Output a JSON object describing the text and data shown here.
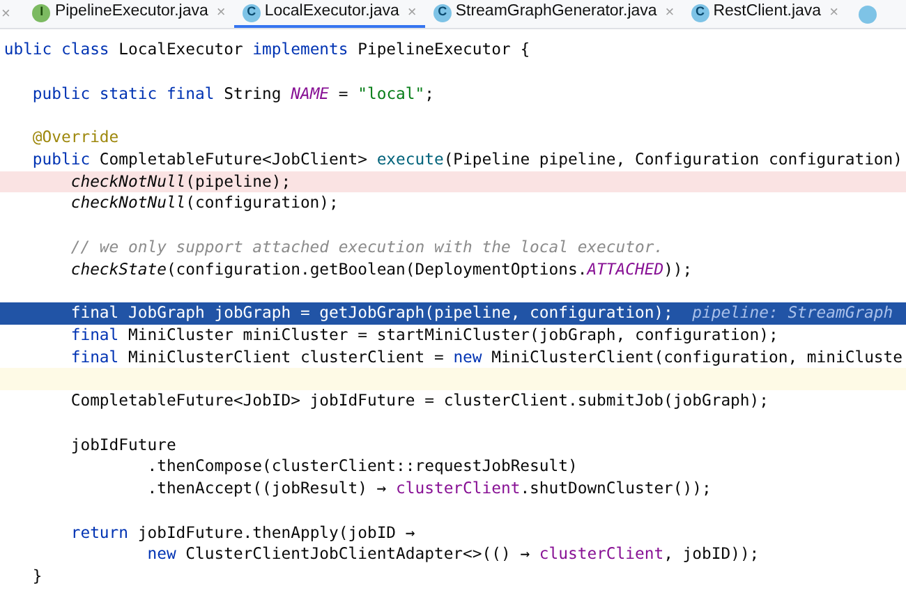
{
  "tabs": {
    "leading_close": "×",
    "items": [
      {
        "kind": "interface",
        "icon": "I",
        "label": "PipelineExecutor.java",
        "close": "×",
        "selected": false
      },
      {
        "kind": "class",
        "icon": "C",
        "label": "LocalExecutor.java",
        "close": "×",
        "selected": true
      },
      {
        "kind": "class",
        "icon": "C",
        "label": "StreamGraphGenerator.java",
        "close": "×",
        "selected": false
      },
      {
        "kind": "class",
        "icon": "C",
        "label": "RestClient.java",
        "close": "×",
        "selected": false
      }
    ],
    "trailing_partial_tab": {
      "kind": "class"
    }
  },
  "editor": {
    "lines": [
      {
        "kind": "normal",
        "tokens": [
          {
            "t": " ublic class",
            "kind": "kw"
          },
          {
            "t": " LocalExecutor ",
            "kind": "plain"
          },
          {
            "t": "implements",
            "kind": "kw"
          },
          {
            "t": " PipelineExecutor {",
            "kind": "plain"
          }
        ]
      },
      {
        "kind": "normal"
      },
      {
        "kind": "normal",
        "tokens": [
          {
            "t": "    public static final",
            "kind": "kw"
          },
          {
            "t": " String ",
            "kind": "plain"
          },
          {
            "t": "NAME",
            "kind": "const"
          },
          {
            "t": " = ",
            "kind": "plain"
          },
          {
            "t": "\"local\"",
            "kind": "string"
          },
          {
            "t": ";",
            "kind": "plain"
          }
        ]
      },
      {
        "kind": "normal"
      },
      {
        "kind": "normal",
        "tokens": [
          {
            "t": "    @Override",
            "kind": "annotation"
          }
        ]
      },
      {
        "kind": "normal",
        "tokens": [
          {
            "t": "    public",
            "kind": "kw"
          },
          {
            "t": " CompletableFuture<JobClient> ",
            "kind": "plain"
          },
          {
            "t": "execute",
            "kind": "decl"
          },
          {
            "t": "(Pipeline pipeline, Configuration configuration)",
            "kind": "plain"
          }
        ]
      },
      {
        "kind": "breakpoint",
        "tokens": [
          {
            "t": "        checkNotNull",
            "kind": "static"
          },
          {
            "t": "(pipeline);",
            "kind": "plain"
          }
        ]
      },
      {
        "kind": "normal",
        "tokens": [
          {
            "t": "        checkNotNull",
            "kind": "static"
          },
          {
            "t": "(configuration);",
            "kind": "plain"
          }
        ]
      },
      {
        "kind": "normal"
      },
      {
        "kind": "normal",
        "tokens": [
          {
            "t": "        // we only support attached execution with the local executor.",
            "kind": "comment"
          }
        ]
      },
      {
        "kind": "normal",
        "tokens": [
          {
            "t": "        checkState",
            "kind": "static"
          },
          {
            "t": "(configuration.getBoolean(DeploymentOptions.",
            "kind": "plain"
          },
          {
            "t": "ATTACHED",
            "kind": "const"
          },
          {
            "t": "));",
            "kind": "plain"
          }
        ]
      },
      {
        "kind": "normal"
      },
      {
        "kind": "execution",
        "tokens": [
          {
            "t": "        final JobGraph jobGraph = getJobGraph(pipeline, configuration);",
            "kind": "plain"
          },
          {
            "t": "  pipeline: StreamGraph",
            "kind": "hint"
          }
        ]
      },
      {
        "kind": "normal",
        "tokens": [
          {
            "t": "        final",
            "kind": "kw"
          },
          {
            "t": " MiniCluster miniCluster = startMiniCluster(jobGraph, configuration);",
            "kind": "plain"
          }
        ]
      },
      {
        "kind": "normal",
        "tokens": [
          {
            "t": "        final",
            "kind": "kw"
          },
          {
            "t": " MiniClusterClient clusterClient = ",
            "kind": "plain"
          },
          {
            "t": "new",
            "kind": "kw"
          },
          {
            "t": " MiniClusterClient(configuration, miniCluste",
            "kind": "plain"
          }
        ]
      },
      {
        "kind": "caret"
      },
      {
        "kind": "normal",
        "tokens": [
          {
            "t": "        CompletableFuture<JobID> jobIdFuture = clusterClient.submitJob(jobGraph);",
            "kind": "plain"
          }
        ]
      },
      {
        "kind": "normal"
      },
      {
        "kind": "normal",
        "tokens": [
          {
            "t": "        jobIdFuture",
            "kind": "plain"
          }
        ]
      },
      {
        "kind": "normal",
        "tokens": [
          {
            "t": "                .thenCompose(clusterClient::requestJobResult)",
            "kind": "plain"
          }
        ]
      },
      {
        "kind": "normal",
        "tokens": [
          {
            "t": "                .thenAccept((jobResult) → ",
            "kind": "plain"
          },
          {
            "t": "clusterClient",
            "kind": "field"
          },
          {
            "t": ".shutDownCluster());",
            "kind": "plain"
          }
        ]
      },
      {
        "kind": "normal"
      },
      {
        "kind": "normal",
        "tokens": [
          {
            "t": "        return",
            "kind": "kw"
          },
          {
            "t": " jobIdFuture.thenApply(jobID →",
            "kind": "plain"
          }
        ]
      },
      {
        "kind": "normal",
        "tokens": [
          {
            "t": "                new",
            "kind": "kw"
          },
          {
            "t": " ClusterClientJobClientAdapter<>(() → ",
            "kind": "plain"
          },
          {
            "t": "clusterClient",
            "kind": "field"
          },
          {
            "t": ", jobID));",
            "kind": "plain"
          }
        ]
      },
      {
        "kind": "normal",
        "tokens": [
          {
            "t": "    }",
            "kind": "plain"
          }
        ]
      }
    ]
  }
}
